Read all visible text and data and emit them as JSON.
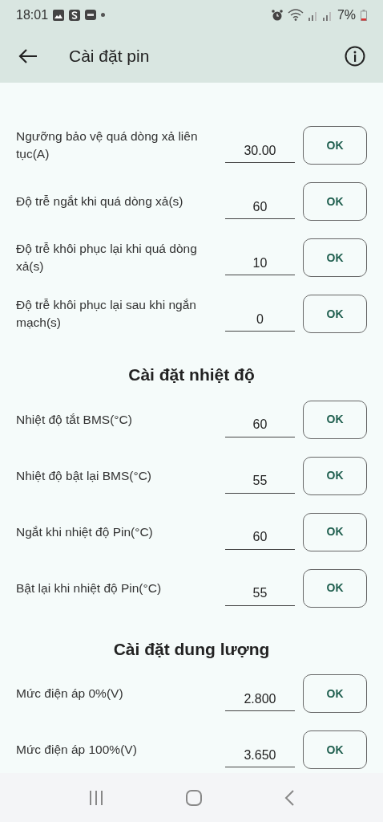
{
  "status_bar": {
    "time": "18:01",
    "battery": "7%"
  },
  "app_bar": {
    "title": "Cài đặt pin"
  },
  "sections": [
    {
      "rows": [
        {
          "label": "Ngưỡng bảo vệ quá dòng xả liên tục(A)",
          "value": "30.00",
          "button": "OK"
        },
        {
          "label": "Độ trễ ngắt khi quá dòng xả(s)",
          "value": "60",
          "button": "OK"
        },
        {
          "label": "Độ trễ khôi phục lại khi quá dòng xả(s)",
          "value": "10",
          "button": "OK"
        },
        {
          "label": "Độ trễ khôi phục lại sau khi ngắn mạch(s)",
          "value": "0",
          "button": "OK"
        }
      ]
    },
    {
      "title": "Cài đặt nhiệt độ",
      "rows": [
        {
          "label": "Nhiệt độ tắt BMS(°C)",
          "value": "60",
          "button": "OK"
        },
        {
          "label": "Nhiệt độ bật lại BMS(°C)",
          "value": "55",
          "button": "OK"
        },
        {
          "label": "Ngắt khi nhiệt độ Pin(°C)",
          "value": "60",
          "button": "OK"
        },
        {
          "label": "Bật lại khi nhiệt độ Pin(°C)",
          "value": "55",
          "button": "OK"
        }
      ]
    },
    {
      "title": "Cài đặt dung lượng",
      "rows": [
        {
          "label": "Mức điện áp 0%(V)",
          "value": "2.800",
          "button": "OK"
        },
        {
          "label": "Mức điện áp 100%(V)",
          "value": "3.650",
          "button": "OK"
        }
      ]
    }
  ]
}
